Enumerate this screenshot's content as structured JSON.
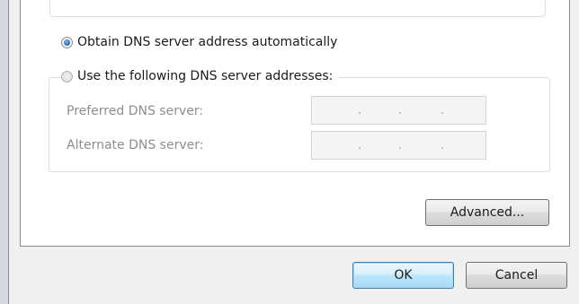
{
  "dns": {
    "auto_option": {
      "label": "Obtain DNS server address automatically",
      "selected": true
    },
    "manual_option": {
      "label": "Use the following DNS server addresses:",
      "selected": false
    },
    "preferred": {
      "label": "Preferred DNS server:",
      "value": ".  .  ."
    },
    "alternate": {
      "label": "Alternate DNS server:",
      "value": ".  .  ."
    }
  },
  "buttons": {
    "advanced": "Advanced...",
    "ok": "OK",
    "cancel": "Cancel"
  }
}
